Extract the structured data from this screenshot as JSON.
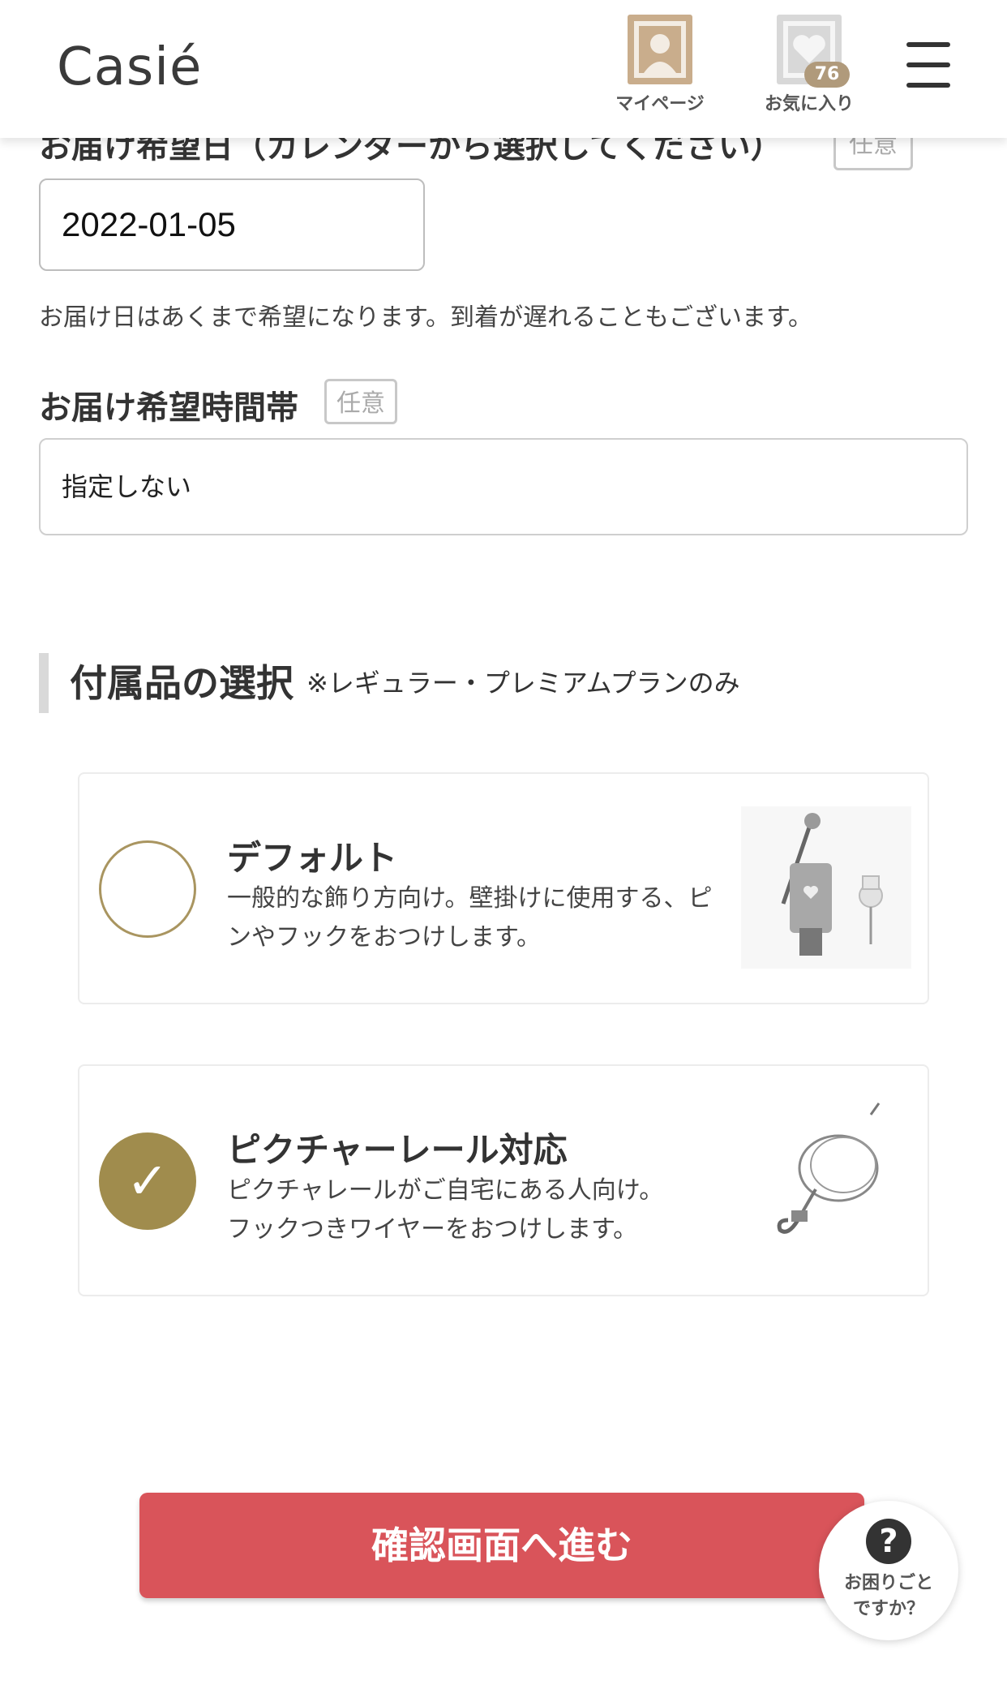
{
  "header": {
    "logo": "Casié",
    "mypage_label": "マイページ",
    "favorites_label": "お気に入り",
    "favorites_count": "76"
  },
  "delivery_date": {
    "label_partial": "お届け希望日（カレンダーから選択してください）",
    "tag": "任意",
    "value": "2022-01-05",
    "note": "お届け日はあくまで希望になります。到着が遅れることもございます。"
  },
  "delivery_time": {
    "label": "お届け希望時間帯",
    "tag": "任意",
    "selected": "指定しない"
  },
  "accessories": {
    "title": "付属品の選択",
    "subtitle": "※レギュラー・プレミアムプランのみ",
    "options": [
      {
        "title": "デフォルト",
        "desc": "一般的な飾り方向け。壁掛けに使用する、ピンやフックをおつけします。",
        "selected": false
      },
      {
        "title": "ピクチャーレール対応",
        "desc_line1": "ピクチャレールがご自宅にある人向け。",
        "desc_line2": "フックつきワイヤーをおつけします。",
        "selected": true
      }
    ]
  },
  "cta_label": "確認画面へ進む",
  "help": {
    "icon": "?",
    "line1": "お困りごと",
    "line2": "ですか？"
  },
  "colors": {
    "accent_gold": "#a08c4d",
    "cta_red": "#d9545a",
    "icon_beige": "#c9ad8c"
  }
}
